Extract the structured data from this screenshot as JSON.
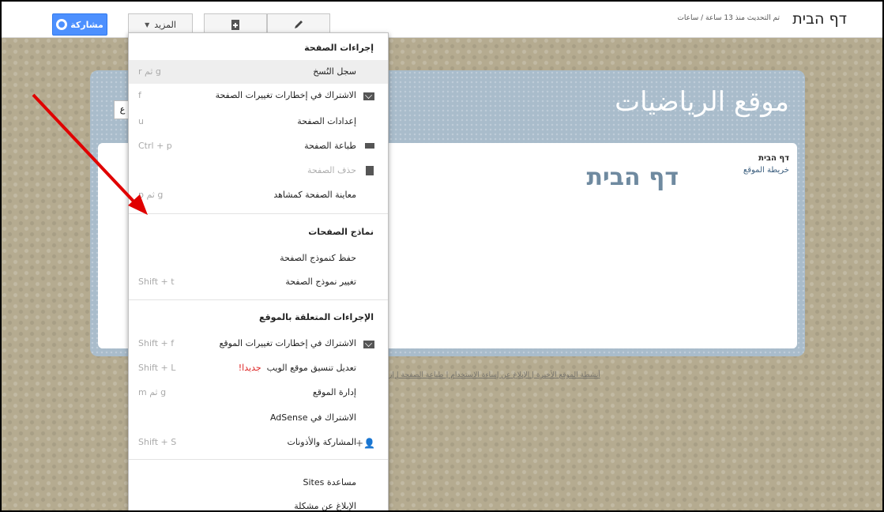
{
  "topbar": {
    "site_name": "דף הבית",
    "updated": "تم التحديث منذ 13 ساعة / ساعات",
    "share_label": "مشاركة",
    "more_label": "المزيد"
  },
  "site": {
    "title": "موقع الرياضيات",
    "page_heading": "דף הבית",
    "nav_active": "דף הבית",
    "nav_sitemap": "خريطة الموقع",
    "search_stub": "ع",
    "footer": "أنشطة الموقع الأخيرة | الإبلاغ عن إساءة الاستخدام | طباعة الصفحة | إزالة"
  },
  "menu": {
    "page_actions_header": "إجراءات الصفحة",
    "items": [
      {
        "label": "سجل النُسخ",
        "shortcut": "r ثم g"
      },
      {
        "label": "الاشتراك في إخطارات تغييرات الصفحة",
        "shortcut": "f"
      },
      {
        "label": "إعدادات الصفحة",
        "shortcut": "u"
      },
      {
        "label": "طباعة الصفحة",
        "shortcut": "Ctrl + p"
      },
      {
        "label": "حذف الصفحة",
        "shortcut": ""
      },
      {
        "label": "معاينة الصفحة كمشاهد",
        "shortcut": "p ثم g"
      }
    ],
    "templates_header": "نماذج الصفحات",
    "template_items": [
      {
        "label": "حفظ كنموذج الصفحة",
        "shortcut": ""
      },
      {
        "label": "تغيير نموذج الصفحة",
        "shortcut": "Shift + t"
      }
    ],
    "site_actions_header": "الإجراءات المتعلقة بالموقع",
    "site_items": [
      {
        "label": "الاشتراك في إخطارات تغييرات الموقع",
        "shortcut": "Shift + f"
      },
      {
        "label": "تعديل تنسيق موقع الويب",
        "new": "جديدا!",
        "shortcut": "Shift + L"
      },
      {
        "label": "إدارة الموقع",
        "shortcut": "m ثم g"
      },
      {
        "label": "الاشتراك في AdSense",
        "shortcut": ""
      },
      {
        "label": "المشاركة والأذونات",
        "shortcut": "Shift + S"
      }
    ],
    "help_items": [
      {
        "label": "مساعدة Sites"
      },
      {
        "label": "الإبلاغ عن مشكلة"
      }
    ]
  },
  "icons": [
    "globe-icon",
    "chevron-down-icon",
    "new-page-icon",
    "pencil-icon",
    "envelope-icon",
    "printer-icon",
    "trash-icon",
    "add-person-icon"
  ],
  "colors": {
    "accent": "#4d90fe",
    "arrow": "#e00000",
    "new_tag": "#dd2222"
  }
}
